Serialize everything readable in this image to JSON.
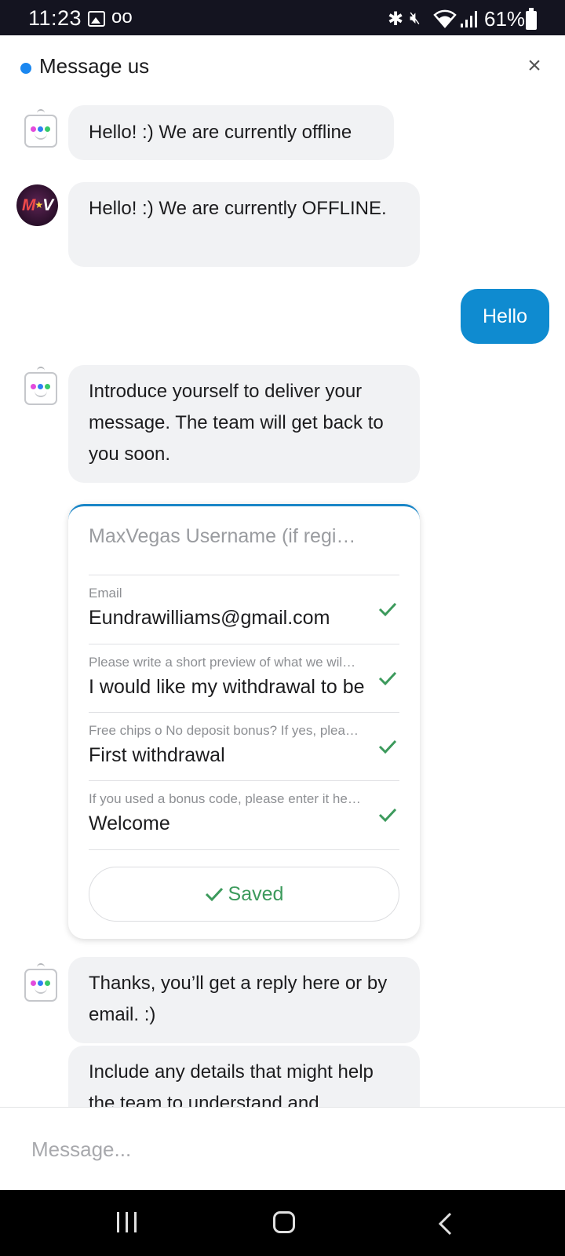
{
  "status_bar": {
    "time": "11:23",
    "voicemail_icon": "oo",
    "battery": "61%"
  },
  "header": {
    "title": "Message us",
    "close_label": "×",
    "status_color": "#1a87f0"
  },
  "conversation": {
    "bot_greeting": "Hello! :) We are currently offline",
    "agent_avatar_text": "MV",
    "agent_message": "Hello! :) We are currently OFFLINE.",
    "user_message": "Hello",
    "bot_intro": "Introduce yourself to deliver your message. The team will get back to you soon.",
    "form": {
      "username_placeholder": "MaxVegas Username (if regi…",
      "fields": [
        {
          "label": "Email",
          "value": "Eundrawilliams@gmail.com"
        },
        {
          "label": "Please write a short preview of what we wil…",
          "value": "I would like my withdrawal to be"
        },
        {
          "label": "Free chips o No deposit bonus? If yes, plea…",
          "value": "First withdrawal"
        },
        {
          "label": "If you used a bonus code, please enter it he…",
          "value": "Welcome"
        }
      ],
      "saved_label": "Saved"
    },
    "bot_thanks": "Thanks, you’ll get a reply here or by email. :)",
    "bot_details": "Include any details that might help the team to understand and"
  },
  "composer": {
    "placeholder": "Message..."
  },
  "colors": {
    "accent_blue": "#0f8bd0",
    "success_green": "#3c9a5c",
    "bubble_gray": "#f1f2f4"
  },
  "icons": {
    "bot_avatar": "robot-icon",
    "check": "checkmark-icon",
    "close": "close-icon"
  }
}
